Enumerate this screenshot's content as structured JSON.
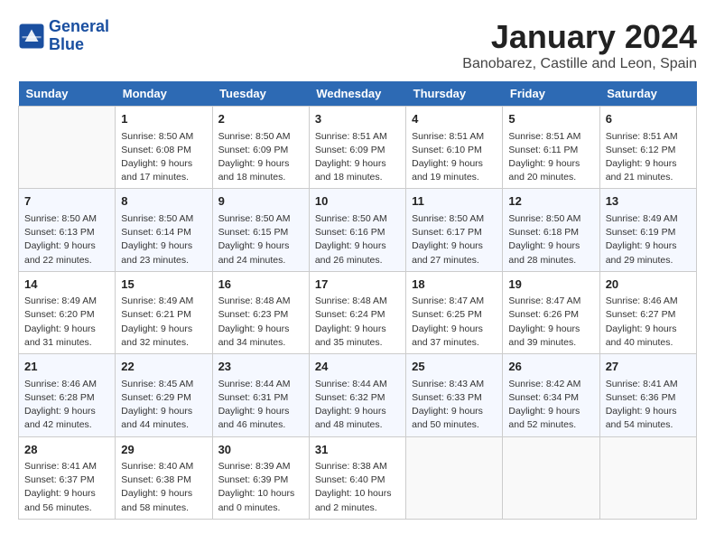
{
  "logo": {
    "line1": "General",
    "line2": "Blue"
  },
  "title": "January 2024",
  "location": "Banobarez, Castille and Leon, Spain",
  "days_of_week": [
    "Sunday",
    "Monday",
    "Tuesday",
    "Wednesday",
    "Thursday",
    "Friday",
    "Saturday"
  ],
  "weeks": [
    [
      {
        "num": "",
        "info": ""
      },
      {
        "num": "1",
        "info": "Sunrise: 8:50 AM\nSunset: 6:08 PM\nDaylight: 9 hours\nand 17 minutes."
      },
      {
        "num": "2",
        "info": "Sunrise: 8:50 AM\nSunset: 6:09 PM\nDaylight: 9 hours\nand 18 minutes."
      },
      {
        "num": "3",
        "info": "Sunrise: 8:51 AM\nSunset: 6:09 PM\nDaylight: 9 hours\nand 18 minutes."
      },
      {
        "num": "4",
        "info": "Sunrise: 8:51 AM\nSunset: 6:10 PM\nDaylight: 9 hours\nand 19 minutes."
      },
      {
        "num": "5",
        "info": "Sunrise: 8:51 AM\nSunset: 6:11 PM\nDaylight: 9 hours\nand 20 minutes."
      },
      {
        "num": "6",
        "info": "Sunrise: 8:51 AM\nSunset: 6:12 PM\nDaylight: 9 hours\nand 21 minutes."
      }
    ],
    [
      {
        "num": "7",
        "info": "Sunrise: 8:50 AM\nSunset: 6:13 PM\nDaylight: 9 hours\nand 22 minutes."
      },
      {
        "num": "8",
        "info": "Sunrise: 8:50 AM\nSunset: 6:14 PM\nDaylight: 9 hours\nand 23 minutes."
      },
      {
        "num": "9",
        "info": "Sunrise: 8:50 AM\nSunset: 6:15 PM\nDaylight: 9 hours\nand 24 minutes."
      },
      {
        "num": "10",
        "info": "Sunrise: 8:50 AM\nSunset: 6:16 PM\nDaylight: 9 hours\nand 26 minutes."
      },
      {
        "num": "11",
        "info": "Sunrise: 8:50 AM\nSunset: 6:17 PM\nDaylight: 9 hours\nand 27 minutes."
      },
      {
        "num": "12",
        "info": "Sunrise: 8:50 AM\nSunset: 6:18 PM\nDaylight: 9 hours\nand 28 minutes."
      },
      {
        "num": "13",
        "info": "Sunrise: 8:49 AM\nSunset: 6:19 PM\nDaylight: 9 hours\nand 29 minutes."
      }
    ],
    [
      {
        "num": "14",
        "info": "Sunrise: 8:49 AM\nSunset: 6:20 PM\nDaylight: 9 hours\nand 31 minutes."
      },
      {
        "num": "15",
        "info": "Sunrise: 8:49 AM\nSunset: 6:21 PM\nDaylight: 9 hours\nand 32 minutes."
      },
      {
        "num": "16",
        "info": "Sunrise: 8:48 AM\nSunset: 6:23 PM\nDaylight: 9 hours\nand 34 minutes."
      },
      {
        "num": "17",
        "info": "Sunrise: 8:48 AM\nSunset: 6:24 PM\nDaylight: 9 hours\nand 35 minutes."
      },
      {
        "num": "18",
        "info": "Sunrise: 8:47 AM\nSunset: 6:25 PM\nDaylight: 9 hours\nand 37 minutes."
      },
      {
        "num": "19",
        "info": "Sunrise: 8:47 AM\nSunset: 6:26 PM\nDaylight: 9 hours\nand 39 minutes."
      },
      {
        "num": "20",
        "info": "Sunrise: 8:46 AM\nSunset: 6:27 PM\nDaylight: 9 hours\nand 40 minutes."
      }
    ],
    [
      {
        "num": "21",
        "info": "Sunrise: 8:46 AM\nSunset: 6:28 PM\nDaylight: 9 hours\nand 42 minutes."
      },
      {
        "num": "22",
        "info": "Sunrise: 8:45 AM\nSunset: 6:29 PM\nDaylight: 9 hours\nand 44 minutes."
      },
      {
        "num": "23",
        "info": "Sunrise: 8:44 AM\nSunset: 6:31 PM\nDaylight: 9 hours\nand 46 minutes."
      },
      {
        "num": "24",
        "info": "Sunrise: 8:44 AM\nSunset: 6:32 PM\nDaylight: 9 hours\nand 48 minutes."
      },
      {
        "num": "25",
        "info": "Sunrise: 8:43 AM\nSunset: 6:33 PM\nDaylight: 9 hours\nand 50 minutes."
      },
      {
        "num": "26",
        "info": "Sunrise: 8:42 AM\nSunset: 6:34 PM\nDaylight: 9 hours\nand 52 minutes."
      },
      {
        "num": "27",
        "info": "Sunrise: 8:41 AM\nSunset: 6:36 PM\nDaylight: 9 hours\nand 54 minutes."
      }
    ],
    [
      {
        "num": "28",
        "info": "Sunrise: 8:41 AM\nSunset: 6:37 PM\nDaylight: 9 hours\nand 56 minutes."
      },
      {
        "num": "29",
        "info": "Sunrise: 8:40 AM\nSunset: 6:38 PM\nDaylight: 9 hours\nand 58 minutes."
      },
      {
        "num": "30",
        "info": "Sunrise: 8:39 AM\nSunset: 6:39 PM\nDaylight: 10 hours\nand 0 minutes."
      },
      {
        "num": "31",
        "info": "Sunrise: 8:38 AM\nSunset: 6:40 PM\nDaylight: 10 hours\nand 2 minutes."
      },
      {
        "num": "",
        "info": ""
      },
      {
        "num": "",
        "info": ""
      },
      {
        "num": "",
        "info": ""
      }
    ]
  ]
}
